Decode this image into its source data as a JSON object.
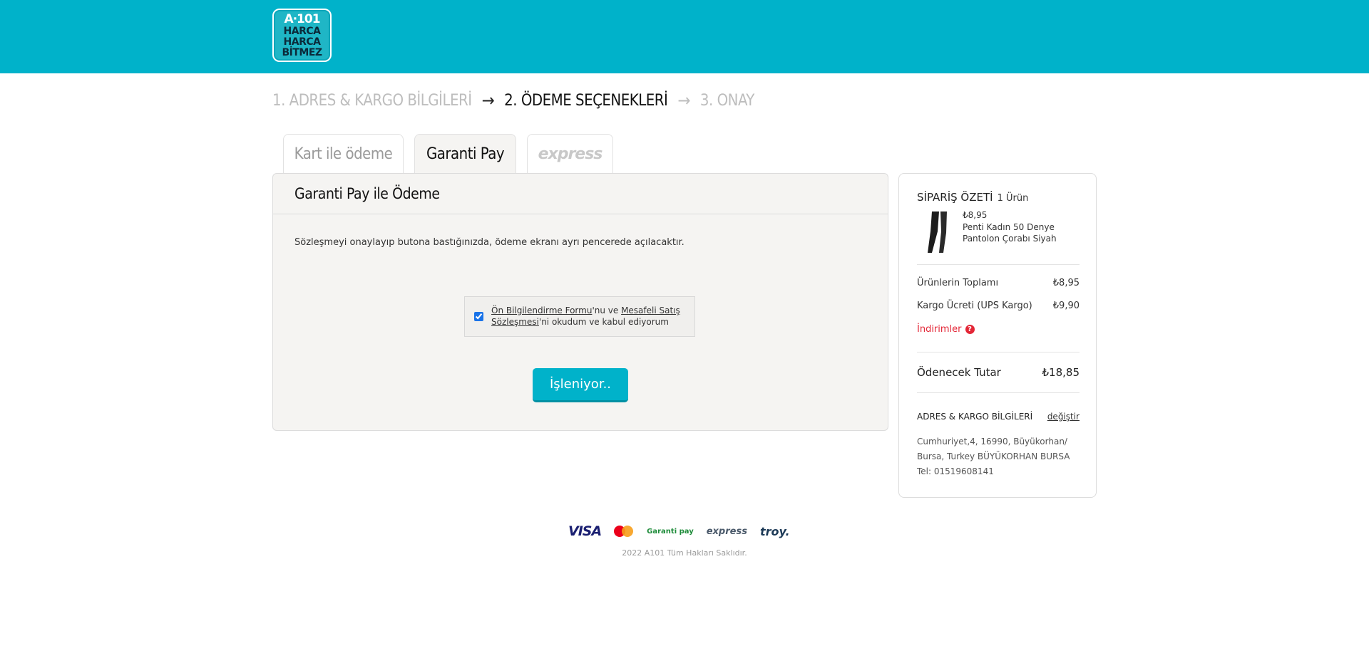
{
  "brand": {
    "logo_line1": "A·101",
    "logo_line2": "HARCA",
    "logo_line3": "HARCA",
    "logo_line4": "BİTMEZ",
    "color": "#00b2ca"
  },
  "steps": [
    {
      "label": "1. ADRES & KARGO BİLGİLERİ",
      "state": "done"
    },
    {
      "label": "2. ÖDEME SEÇENEKLERİ",
      "state": "active"
    },
    {
      "label": "3. ONAY",
      "state": "pending"
    }
  ],
  "tabs": [
    {
      "label": "Kart ile ödeme"
    },
    {
      "label": "Garanti Pay"
    },
    {
      "label": "express"
    }
  ],
  "payment": {
    "title": "Garanti Pay ile Ödeme",
    "info": "Sözleşmeyi onaylayıp butona bastığınızda, ödeme ekranı ayrı pencerede açılacaktır.",
    "consent_link1": "Ön Bilgilendirme Formu",
    "consent_mid": "'nu ve ",
    "consent_link2": "Mesafeli Satış Sözleşmesi",
    "consent_end": "'ni okudum ve kabul ediyorum",
    "consent_checked": true,
    "button_label": "İşleniyor.."
  },
  "summary": {
    "title": "SİPARİŞ ÖZETİ",
    "count": "1 Ürün",
    "product_price": "₺8,95",
    "product_name": "Penti Kadın 50 Denye Pantolon Çorabı Siyah",
    "subtotal_label": "Ürünlerin Toplamı",
    "subtotal_value": "₺8,95",
    "shipping_label": "Kargo Ücreti (UPS Kargo)",
    "shipping_value": "₺9,90",
    "discounts_label": "İndirimler",
    "total_label": "Ödenecek Tutar",
    "total_value": "₺18,85",
    "address_title": "ADRES & KARGO BİLGİLERİ",
    "change_label": "değiştir",
    "address_line1": "Cumhuriyet,4, 16990, Büyükorhan/",
    "address_line2": "Bursa, Turkey BÜYÜKORHAN BURSA",
    "phone": "Tel: 01519608141"
  },
  "footer": {
    "visa": "VISA",
    "garanti_pay": "Garanti pay",
    "bkm": "express",
    "troy": "troy.",
    "copyright": "2022 A101 Tüm Hakları Saklıdır."
  }
}
